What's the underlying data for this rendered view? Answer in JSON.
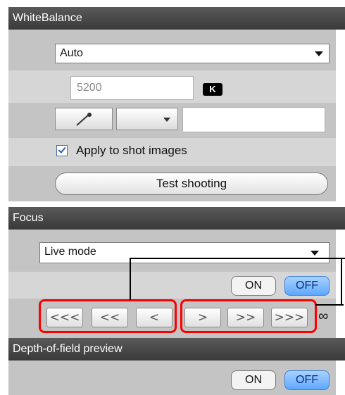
{
  "white_balance": {
    "header": "WhiteBalance",
    "mode_select": "Auto",
    "kelvin_value": "5200",
    "kelvin_unit": "K",
    "apply_checkbox_label": "Apply to shot images",
    "apply_checked": true,
    "test_shooting_label": "Test shooting"
  },
  "focus": {
    "header": "Focus",
    "mode_select": "Live mode",
    "on_label": "ON",
    "off_label": "OFF",
    "nav_buttons": [
      "<<<",
      "<<",
      "<",
      ">",
      ">>",
      ">>>"
    ],
    "infinity": "∞"
  },
  "depth_of_field": {
    "header": "Depth-of-field preview",
    "on_label": "ON",
    "off_label": "OFF"
  },
  "colors": {
    "header_bg": "#3f3f3f",
    "panel_dark": "#c4c4c4",
    "panel_light": "#d6d6d6",
    "off_active": "#5ea8ff",
    "highlight_frame": "#ff0000"
  }
}
